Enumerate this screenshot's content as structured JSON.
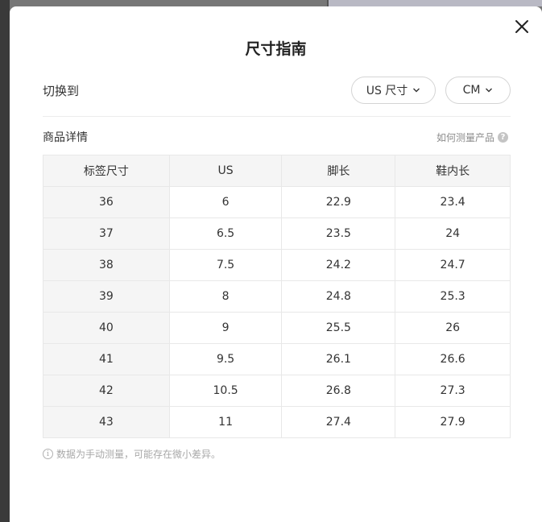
{
  "modal": {
    "title": "尺寸指南"
  },
  "switch": {
    "label": "切换到",
    "size_system": "US 尺寸",
    "unit": "CM"
  },
  "details": {
    "label": "商品详情",
    "how_to_measure": "如何测量产品",
    "help_glyph": "?"
  },
  "table": {
    "headers": [
      "标签尺寸",
      "US",
      "脚长",
      "鞋内长"
    ],
    "rows": [
      [
        "36",
        "6",
        "22.9",
        "23.4"
      ],
      [
        "37",
        "6.5",
        "23.5",
        "24"
      ],
      [
        "38",
        "7.5",
        "24.2",
        "24.7"
      ],
      [
        "39",
        "8",
        "24.8",
        "25.3"
      ],
      [
        "40",
        "9",
        "25.5",
        "26"
      ],
      [
        "41",
        "9.5",
        "26.1",
        "26.6"
      ],
      [
        "42",
        "10.5",
        "26.8",
        "27.3"
      ],
      [
        "43",
        "11",
        "27.4",
        "27.9"
      ]
    ]
  },
  "note": {
    "info_glyph": "i",
    "text": "数据为手动测量，可能存在微小差异。"
  },
  "icons": {
    "close": "close-icon",
    "chevron": "chevron-down-icon",
    "help": "question-icon",
    "info": "info-icon"
  }
}
